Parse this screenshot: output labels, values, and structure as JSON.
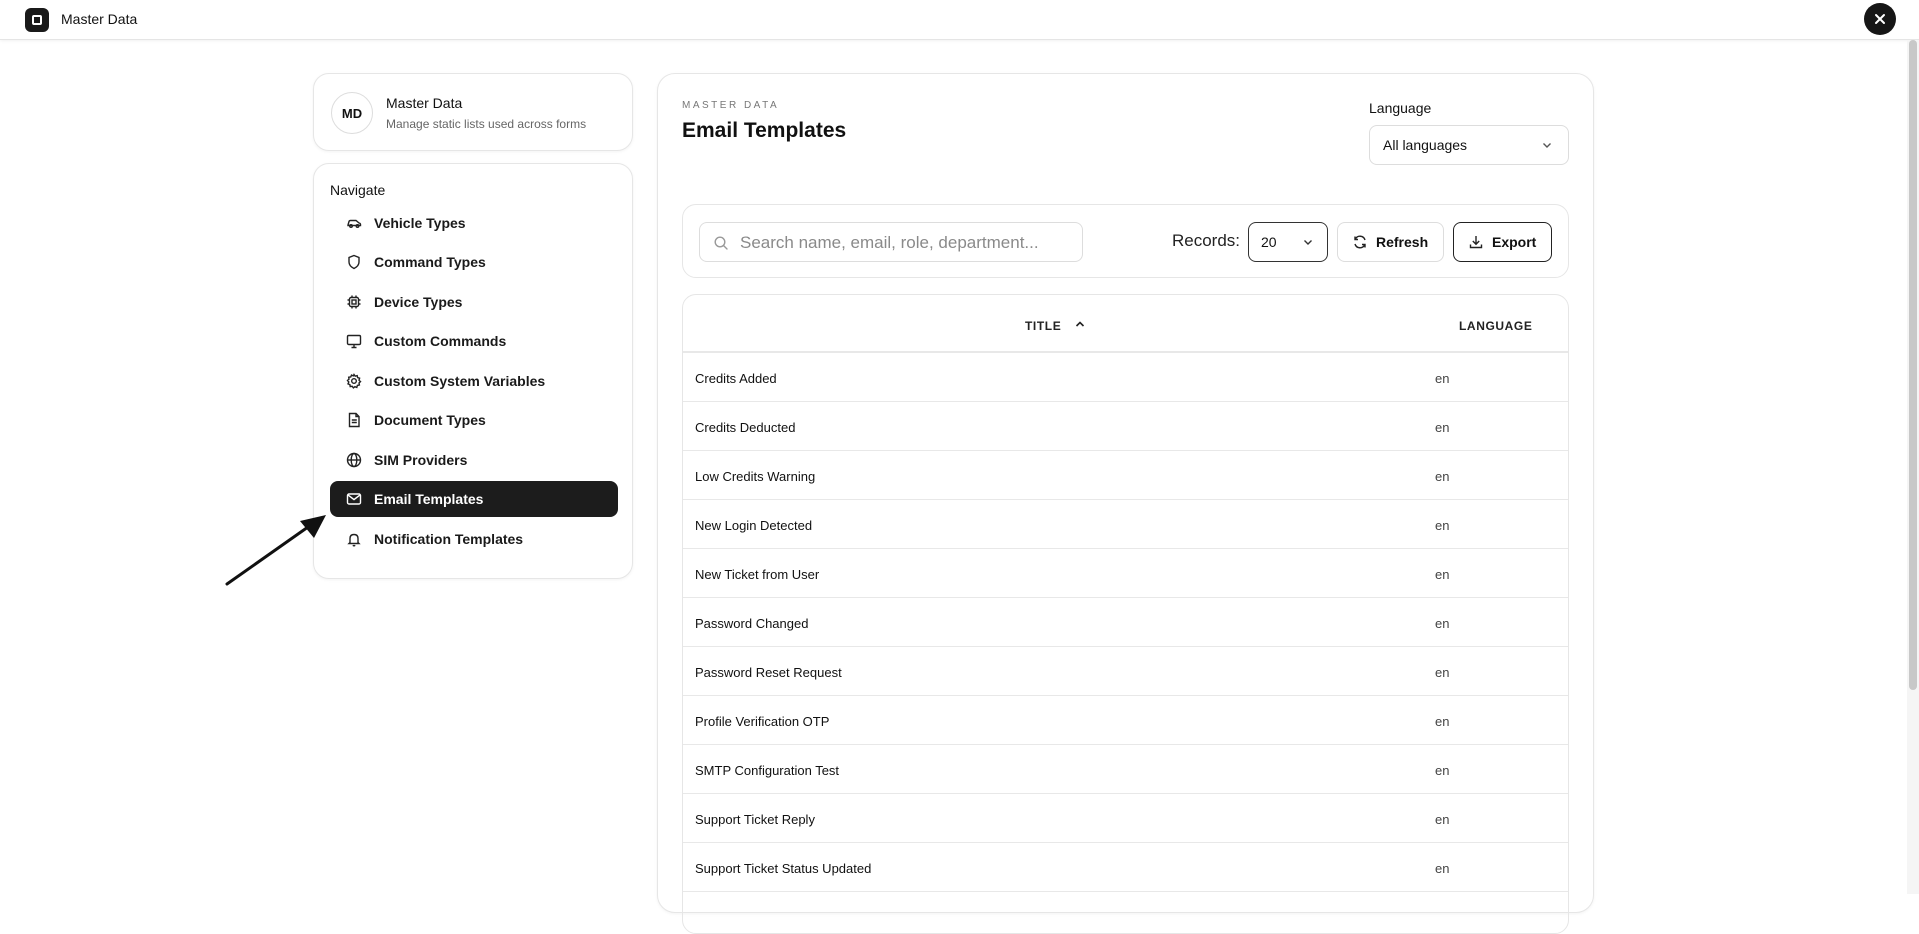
{
  "app": {
    "title": "Master Data",
    "close_icon": "close-icon"
  },
  "profile": {
    "initials": "MD",
    "name": "Master Data",
    "subtitle": "Manage static lists used across forms"
  },
  "nav": {
    "heading": "Navigate",
    "items": [
      {
        "label": "Vehicle Types",
        "icon": "car-icon",
        "active": false
      },
      {
        "label": "Command Types",
        "icon": "shield-icon",
        "active": false
      },
      {
        "label": "Device Types",
        "icon": "cpu-icon",
        "active": false
      },
      {
        "label": "Custom Commands",
        "icon": "monitor-icon",
        "active": false
      },
      {
        "label": "Custom System Variables",
        "icon": "gear-icon",
        "active": false
      },
      {
        "label": "Document Types",
        "icon": "document-icon",
        "active": false
      },
      {
        "label": "SIM Providers",
        "icon": "globe-icon",
        "active": false
      },
      {
        "label": "Email Templates",
        "icon": "mail-icon",
        "active": true
      },
      {
        "label": "Notification Templates",
        "icon": "bell-icon",
        "active": false
      }
    ]
  },
  "main": {
    "eyebrow": "MASTER DATA",
    "title": "Email Templates",
    "language_label": "Language",
    "language_value": "All languages"
  },
  "toolbar": {
    "search_placeholder": "Search name, email, role, department...",
    "records_label": "Records:",
    "records_value": "20",
    "refresh_label": "Refresh",
    "export_label": "Export"
  },
  "table": {
    "columns": {
      "title": "TITLE",
      "language": "LANGUAGE"
    },
    "sort": "ascending",
    "rows": [
      {
        "title": "Credits Added",
        "language": "en"
      },
      {
        "title": "Credits Deducted",
        "language": "en"
      },
      {
        "title": "Low Credits Warning",
        "language": "en"
      },
      {
        "title": "New Login Detected",
        "language": "en"
      },
      {
        "title": "New Ticket from User",
        "language": "en"
      },
      {
        "title": "Password Changed",
        "language": "en"
      },
      {
        "title": "Password Reset Request",
        "language": "en"
      },
      {
        "title": "Profile Verification OTP",
        "language": "en"
      },
      {
        "title": "SMTP Configuration Test",
        "language": "en"
      },
      {
        "title": "Support Ticket Reply",
        "language": "en"
      },
      {
        "title": "Support Ticket Status Updated",
        "language": "en"
      }
    ]
  }
}
